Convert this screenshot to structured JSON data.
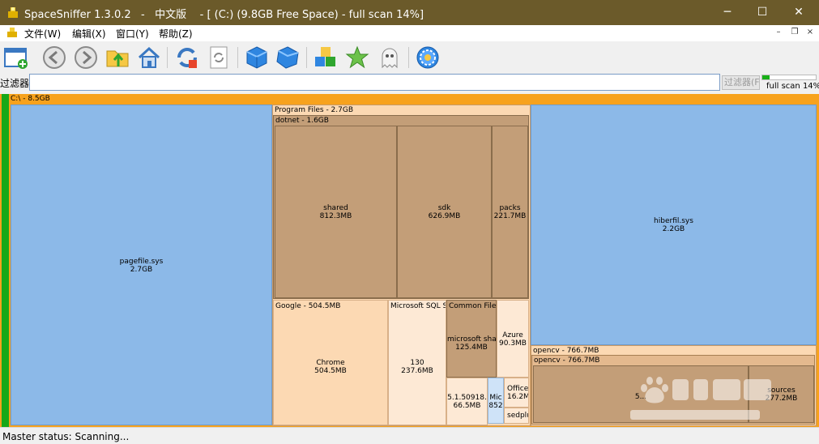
{
  "window": {
    "title": "SpaceSniffer 1.3.0.2   -   中文版    - [ (C:) (9.8GB Free Space) - full scan 14%]"
  },
  "menu": [
    "文件(W)",
    "编辑(X)",
    "窗口(Y)",
    "帮助(Z)"
  ],
  "toolbar": {
    "buttons": [
      "new-window-icon",
      "back-icon",
      "forward-icon",
      "open-folder-icon",
      "home-icon",
      "refresh-icon",
      "reload-icon",
      "blue-cube-icon",
      "blue-cube-tilted-icon",
      "cubes-icon",
      "star-icon",
      "ghost-icon",
      "settings-gear-icon"
    ]
  },
  "filter": {
    "label": "过滤器",
    "value": "",
    "button_label": "过滤器(F",
    "scan_label": "full scan 14%",
    "scan_progress": 0.14
  },
  "treemap": {
    "root_label": "C:\\ - 8.5GB",
    "pagefile": {
      "name": "pagefile.sys",
      "size": "2.7GB"
    },
    "program_files": {
      "label": "Program Files - 2.7GB",
      "dotnet": {
        "label": "dotnet - 1.6GB",
        "shared": {
          "name": "shared",
          "size": "812.3MB"
        },
        "sdk": {
          "name": "sdk",
          "size": "626.9MB"
        },
        "packs": {
          "name": "packs",
          "size": "221.7MB"
        }
      },
      "google": {
        "label": "Google - 504.5MB",
        "chrome": {
          "name": "Chrome",
          "size": "504.5MB"
        }
      },
      "mssql": {
        "label": "Microsoft SQL Se",
        "v130": {
          "name": "130",
          "size": "237.6MB"
        }
      },
      "common_files": {
        "label": "Common Files",
        "ms_shared": {
          "name": "microsoft sha",
          "size": "125.4MB"
        }
      },
      "azure": {
        "name": "Azure",
        "size": "90.3MB"
      },
      "version": {
        "name": "5.1.50918.",
        "size": "66.5MB"
      },
      "mic": {
        "name": "Mic",
        "size": "852"
      },
      "office": {
        "name": "Office",
        "size": "16.2M"
      },
      "sedplu": {
        "name": "sedplu"
      }
    },
    "hiberfil": {
      "name": "hiberfil.sys",
      "size": "2.2GB"
    },
    "opencv_outer": {
      "label": "opencv - 766.7MB"
    },
    "opencv_inner": {
      "label": "opencv - 766.7MB",
      "left": {
        "name": "",
        "size": "5..."
      },
      "sources": {
        "name": "sources",
        "size": "277.2MB"
      }
    },
    "colors": {
      "file": "#8cb9e8",
      "folder_brown": "#c39e78",
      "folder_light": "#fcd9b3",
      "folder_pale": "#fde9d5",
      "root": "#f7a21d",
      "scan": "#17a817"
    }
  },
  "status": {
    "text": "Master status: Scanning..."
  }
}
